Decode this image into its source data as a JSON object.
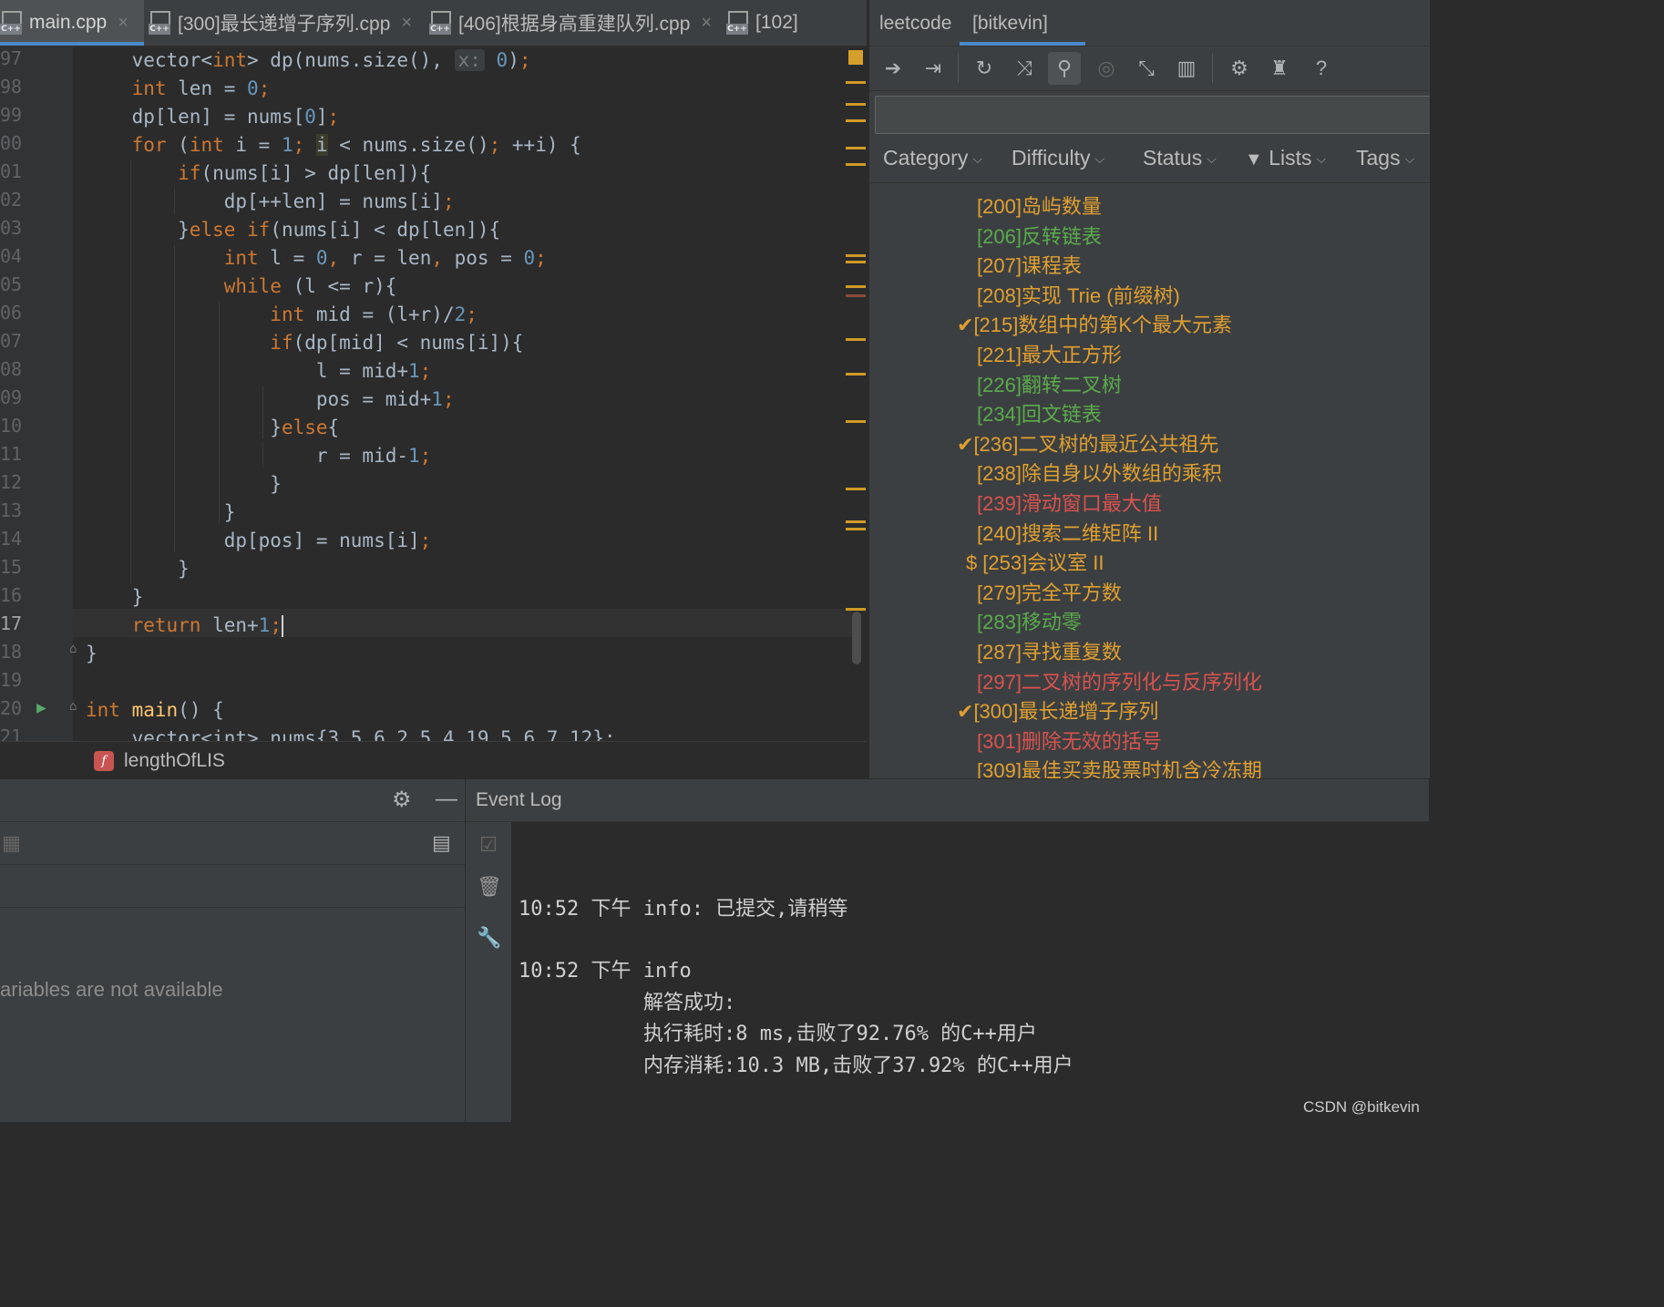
{
  "editor_tabs": [
    {
      "label": "main.cpp",
      "active": true
    },
    {
      "label": "[300]最长递增子序列.cpp",
      "active": false
    },
    {
      "label": "[406]根据身高重建队列.cpp",
      "active": false
    },
    {
      "label": "[102]",
      "active": false
    }
  ],
  "code": {
    "line_numbers": [
      "97",
      "98",
      "99",
      "00",
      "01",
      "02",
      "03",
      "04",
      "05",
      "06",
      "07",
      "08",
      "09",
      "10",
      "11",
      "12",
      "13",
      "14",
      "15",
      "16",
      "17",
      "18",
      "19",
      "20",
      "21"
    ],
    "inlay_hint": "x:",
    "final_line": "vector<int> nums{3,5,6,2,5,4,19,5,6,7,12};"
  },
  "breadcrumb": {
    "icon": "f",
    "label": "lengthOfLIS"
  },
  "leetcode": {
    "tabs": [
      "leetcode",
      "[bitkevin]"
    ],
    "search_value": "",
    "filters": [
      "Category",
      "Difficulty",
      "Status",
      "Lists",
      "Tags"
    ],
    "problems": [
      {
        "prefix": "",
        "title": "[200]岛屿数量",
        "color": "#e0a030"
      },
      {
        "prefix": "",
        "title": "[206]反转链表",
        "color": "#5aab4c"
      },
      {
        "prefix": "",
        "title": "[207]课程表",
        "color": "#e0a030"
      },
      {
        "prefix": "",
        "title": "[208]实现 Trie (前缀树)",
        "color": "#e0a030"
      },
      {
        "prefix": "✔",
        "title": "[215]数组中的第K个最大元素",
        "color": "#e0a030"
      },
      {
        "prefix": "",
        "title": "[221]最大正方形",
        "color": "#e0a030"
      },
      {
        "prefix": "",
        "title": "[226]翻转二叉树",
        "color": "#5aab4c"
      },
      {
        "prefix": "",
        "title": "[234]回文链表",
        "color": "#5aab4c"
      },
      {
        "prefix": "✔",
        "title": "[236]二叉树的最近公共祖先",
        "color": "#e0a030"
      },
      {
        "prefix": "",
        "title": "[238]除自身以外数组的乘积",
        "color": "#e0a030"
      },
      {
        "prefix": "",
        "title": "[239]滑动窗口最大值",
        "color": "#d9534f"
      },
      {
        "prefix": "",
        "title": "[240]搜索二维矩阵 II",
        "color": "#e0a030"
      },
      {
        "prefix": "$",
        "title": "[253]会议室 II",
        "color": "#e0a030"
      },
      {
        "prefix": "",
        "title": "[279]完全平方数",
        "color": "#e0a030"
      },
      {
        "prefix": "",
        "title": "[283]移动零",
        "color": "#5aab4c"
      },
      {
        "prefix": "",
        "title": "[287]寻找重复数",
        "color": "#e0a030"
      },
      {
        "prefix": "",
        "title": "[297]二叉树的序列化与反序列化",
        "color": "#d9534f"
      },
      {
        "prefix": "✔",
        "title": "[300]最长递增子序列",
        "color": "#e0a030"
      },
      {
        "prefix": "",
        "title": "[301]删除无效的括号",
        "color": "#d9534f"
      },
      {
        "prefix": "",
        "title": "[309]最佳买卖股票时机含冷冻期",
        "color": "#e0a030"
      }
    ]
  },
  "debug_panel": {
    "message": "ariables are not available"
  },
  "event_log": {
    "title": "Event Log",
    "entries": [
      "10:52 下午 info: 已提交,请稍等",
      "10:52 下午 info",
      "解答成功:",
      "执行耗时:8 ms,击败了92.76% 的C++用户",
      "内存消耗:10.3 MB,击败了37.92% 的C++用户"
    ]
  },
  "watermark": "CSDN @bitkevin"
}
